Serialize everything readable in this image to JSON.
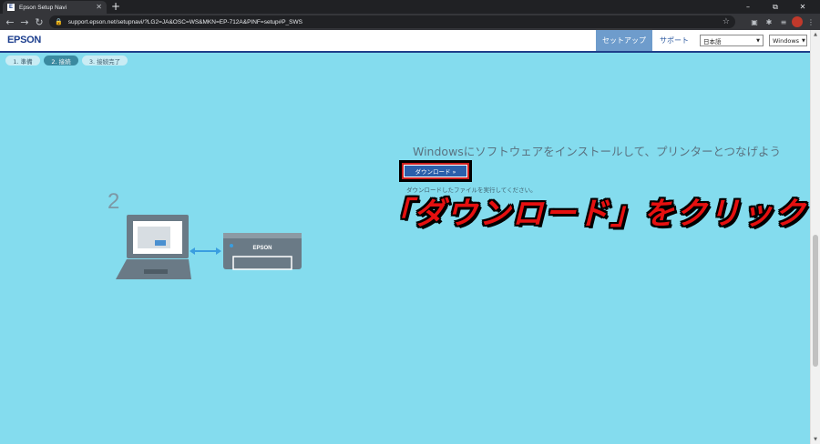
{
  "browser": {
    "tab_title": "Epson Setup Navi",
    "tab_favicon": "E",
    "new_tab_label": "+",
    "url": "support.epson.net/setupnavi/?LG2=JA&OSC=WS&MKN=EP-712A&PINF=setup#P_SWS",
    "window_controls": [
      "–",
      "⧉",
      "✕"
    ]
  },
  "header": {
    "logo": "EPSON",
    "nav_setup": "セットアップ",
    "nav_support": "サポート",
    "language_select": "日本語",
    "os_select": "Windows"
  },
  "steps": [
    {
      "label": "1. 準備",
      "active": false
    },
    {
      "label": "2. 接続",
      "active": true
    },
    {
      "label": "3. 接続完了",
      "active": false
    }
  ],
  "content": {
    "headline": "Windowsにソフトウェアをインストールして、プリンターとつなげよう",
    "download_button": "ダウンロード »",
    "instruction": "ダウンロードしたファイルを実行してください。",
    "step_number": "2",
    "printer_brand": "EPSON"
  },
  "callout": {
    "text": "「ダウンロード」をクリック"
  },
  "colors": {
    "background": "#84dcee",
    "accent": "#2b5fab",
    "callout": "#e61010"
  }
}
